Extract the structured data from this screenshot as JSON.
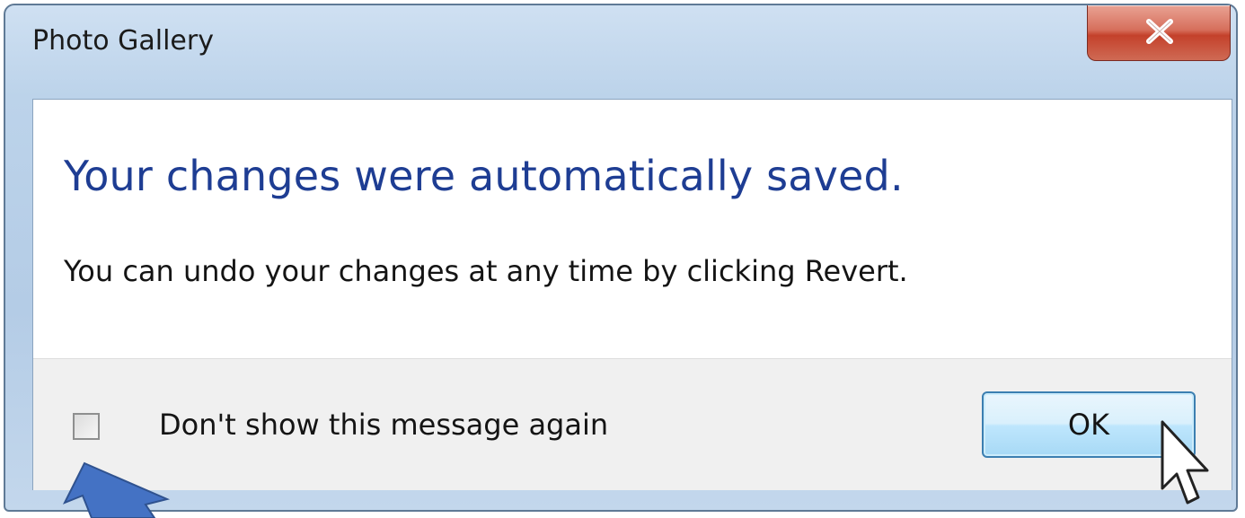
{
  "window": {
    "title": "Photo Gallery"
  },
  "dialog": {
    "heading": "Your changes were automatically saved.",
    "message": "You can undo your changes at any time by clicking Revert.",
    "checkbox_label": "Don't show this message again",
    "checkbox_checked": false,
    "ok_label": "OK"
  },
  "colors": {
    "heading_blue": "#1e3d93",
    "close_button_red": "#c4412b",
    "annotation_arrow": "#4472c4"
  },
  "icons": {
    "close": "close-icon",
    "cursor": "mouse-pointer-icon",
    "annotation": "annotation-arrow"
  }
}
